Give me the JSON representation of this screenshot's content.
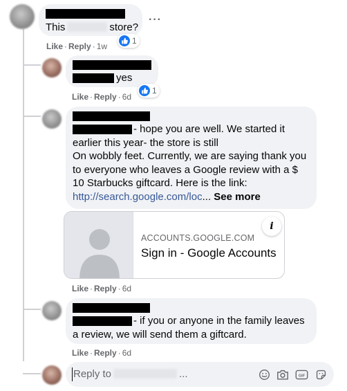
{
  "actions": {
    "like": "Like",
    "reply": "Reply",
    "separator": "·"
  },
  "comments": [
    {
      "text_prefix": "This",
      "text_suffix": "store?",
      "time": "1w",
      "reaction_count": "1"
    },
    {
      "text": "yes",
      "time": "6d",
      "reaction_count": "1"
    },
    {
      "text_line1": "- hope you are well. We started it",
      "text_line2": "earlier this year- the store is still",
      "text_line3": "On wobbly feet. Currently, we are saying thank you",
      "text_line4": "to everyone who leaves a Google review with a $",
      "text_line5": "10 Starbucks giftcard. Here is the link:",
      "link_text": "http://search.google.com/loc",
      "ellipsis": "...",
      "see_more": "See more",
      "card": {
        "domain": "ACCOUNTS.GOOGLE.COM",
        "title": "Sign in - Google Accounts",
        "info_glyph": "i"
      },
      "time": "6d"
    },
    {
      "text_line1": "- if you or anyone in the family leaves",
      "text_line2": "a review, we will send them a giftcard.",
      "time": "6d"
    }
  ],
  "reply_box": {
    "placeholder_prefix": "Reply to",
    "placeholder_suffix": "...",
    "icons": [
      "emoji-icon",
      "camera-icon",
      "gif-icon",
      "sticker-icon"
    ],
    "gif_label": "GIF"
  },
  "more_options": "···",
  "colors": {
    "bubble": "#f0f2f5",
    "like_blue": "#1877f2",
    "link": "#385898",
    "meta": "#65676b",
    "thread_line": "#ced0d4"
  }
}
